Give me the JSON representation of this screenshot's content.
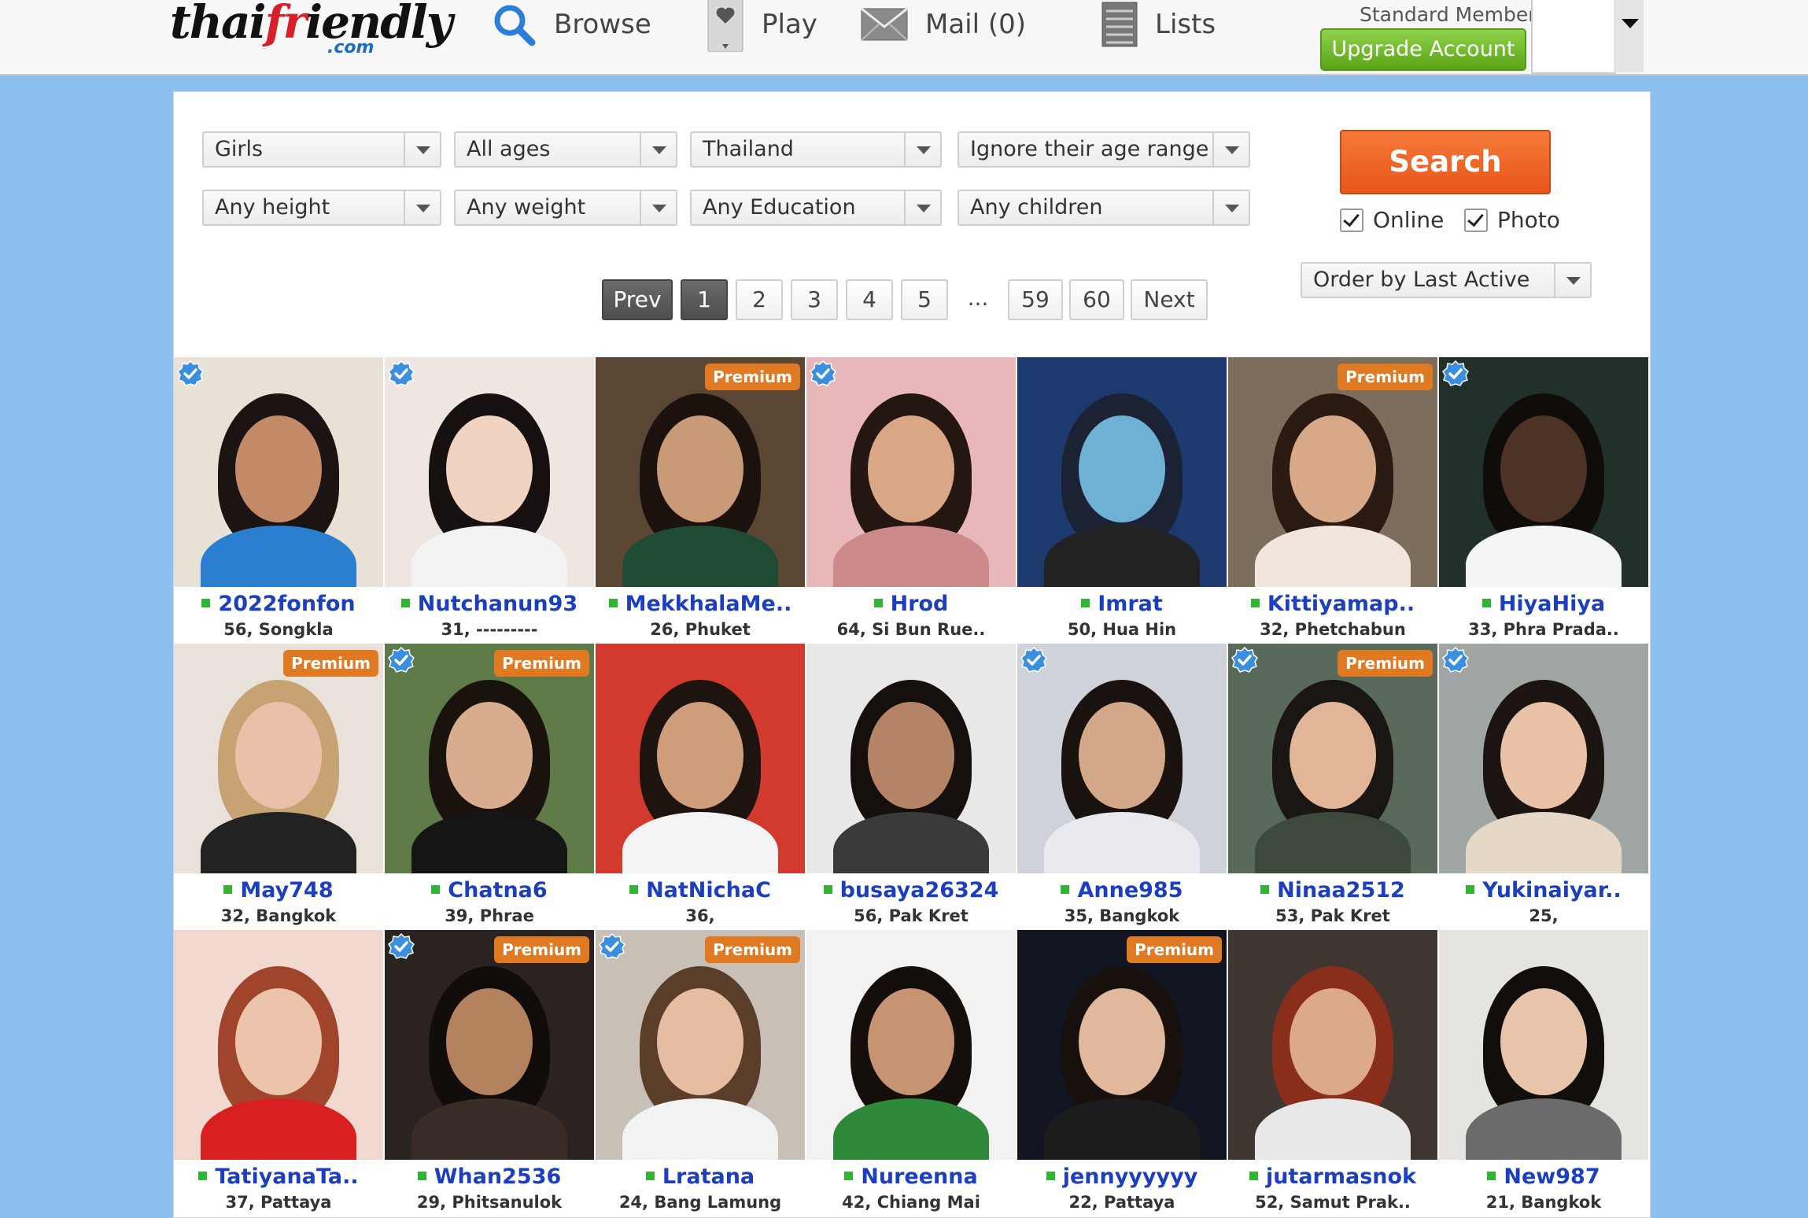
{
  "header": {
    "logo_text_a": "thai",
    "logo_text_b": "fr",
    "logo_text_c": "iendly",
    "logo_com": ".com",
    "nav": [
      {
        "label": "Browse",
        "icon": "search-icon"
      },
      {
        "label": "Play",
        "icon": "heart-card-icon"
      },
      {
        "label": "Mail (0)",
        "icon": "mail-icon"
      },
      {
        "label": "Lists",
        "icon": "list-icon"
      }
    ],
    "member_status": "Standard Member",
    "upgrade_label": "Upgrade Account"
  },
  "filters": {
    "row1": [
      "Girls",
      "All ages",
      "Thailand",
      "Ignore their age range"
    ],
    "row2": [
      "Any height",
      "Any weight",
      "Any Education",
      "Any children"
    ],
    "search_label": "Search",
    "online_label": "Online",
    "photo_label": "Photo",
    "order_label": "Order by Last Active"
  },
  "pager": {
    "prev": "Prev",
    "pages": [
      "1",
      "2",
      "3",
      "4",
      "5",
      "...",
      "59",
      "60"
    ],
    "current": "1",
    "next": "Next"
  },
  "badges": {
    "premium": "Premium"
  },
  "profiles": [
    {
      "name": "2022fonfon",
      "info": "56, Songkla",
      "verified": true,
      "premium": false,
      "bg": "#e8e2d6",
      "skin": "#c28a66",
      "hair": "#1b1412",
      "top": "#2a7fd0"
    },
    {
      "name": "Nutchanun93",
      "info": "31, ---------",
      "verified": true,
      "premium": false,
      "bg": "#efe6e2",
      "skin": "#f1d3c2",
      "hair": "#161010",
      "top": "#f3f3f3"
    },
    {
      "name": "MekkhalaMe..",
      "info": "26, Phuket",
      "verified": false,
      "premium": true,
      "bg": "#5b4634",
      "skin": "#c99a78",
      "hair": "#1b120e",
      "top": "#1f4a33"
    },
    {
      "name": "Hrod",
      "info": "64, Si Bun Rue..",
      "verified": true,
      "premium": false,
      "bg": "#e8b7b9",
      "skin": "#d9a786",
      "hair": "#241610",
      "top": "#cc8a8a"
    },
    {
      "name": "Imrat",
      "info": "50, Hua Hin",
      "verified": false,
      "premium": false,
      "bg": "#1d3a6e",
      "skin": "#6fb1d4",
      "hair": "#1a2233",
      "top": "#222"
    },
    {
      "name": "Kittiyamap..",
      "info": "32, Phetchabun",
      "verified": false,
      "premium": true,
      "bg": "#7d6d5c",
      "skin": "#d8a988",
      "hair": "#2a1a12",
      "top": "#f0e6de"
    },
    {
      "name": "HiyaHiya",
      "info": "33, Phra Prada..",
      "verified": true,
      "premium": false,
      "bg": "#22302a",
      "skin": "#4d3326",
      "hair": "#0f0c0a",
      "top": "#f5f5f5"
    },
    {
      "name": "May748",
      "info": "32, Bangkok",
      "verified": false,
      "premium": true,
      "bg": "#e9e2da",
      "skin": "#e9c0a8",
      "hair": "#c7a273",
      "top": "#222"
    },
    {
      "name": "Chatna6",
      "info": "39, Phrae",
      "verified": true,
      "premium": true,
      "bg": "#5d7a47",
      "skin": "#d8ad8d",
      "hair": "#1a120d",
      "top": "#151515"
    },
    {
      "name": "NatNichaC",
      "info": "36,",
      "verified": false,
      "premium": false,
      "bg": "#d23a2e",
      "skin": "#cf9d7c",
      "hair": "#1d140f",
      "top": "#f4f4f4"
    },
    {
      "name": "busaya26324",
      "info": "56, Pak Kret",
      "verified": false,
      "premium": false,
      "bg": "#e8e8e8",
      "skin": "#b58466",
      "hair": "#15100d",
      "top": "#3a3a3a"
    },
    {
      "name": "Anne985",
      "info": "35, Bangkok",
      "verified": true,
      "premium": false,
      "bg": "#cfd2d8",
      "skin": "#d3a888",
      "hair": "#19120e",
      "top": "#e9e9ef"
    },
    {
      "name": "Ninaa2512",
      "info": "53, Pak Kret",
      "verified": true,
      "premium": true,
      "bg": "#5a6a5a",
      "skin": "#e2b597",
      "hair": "#1a1614",
      "top": "#3d4a3b"
    },
    {
      "name": "Yukinaiyar..",
      "info": "25,",
      "verified": true,
      "premium": false,
      "bg": "#9fa6a3",
      "skin": "#e9c2a8",
      "hair": "#1b1411",
      "top": "#e6d8c6"
    },
    {
      "name": "TatiyanaTa..",
      "info": "37, Pattaya",
      "verified": false,
      "premium": false,
      "bg": "#f1d9cf",
      "skin": "#ecc3ab",
      "hair": "#a0452b",
      "top": "#d92020"
    },
    {
      "name": "Whan2536",
      "info": "29, Phitsanulok",
      "verified": true,
      "premium": true,
      "bg": "#2a2320",
      "skin": "#b5825f",
      "hair": "#120d0b",
      "top": "#3a2c26"
    },
    {
      "name": "Lratana",
      "info": "24, Bang Lamung",
      "verified": true,
      "premium": true,
      "bg": "#c8c0b6",
      "skin": "#e6bda0",
      "hair": "#5a3e2a",
      "top": "#f2f2f2"
    },
    {
      "name": "Nureenna",
      "info": "42, Chiang Mai",
      "verified": false,
      "premium": false,
      "bg": "#f2f2f2",
      "skin": "#c69472",
      "hair": "#150f0c",
      "top": "#2e8a3a"
    },
    {
      "name": "jennyyyyyy",
      "info": "22, Pattaya",
      "verified": false,
      "premium": true,
      "bg": "#111522",
      "skin": "#e1b89c",
      "hair": "#17100c",
      "top": "#1c1c1c"
    },
    {
      "name": "jutarmasnok",
      "info": "52, Samut Prak..",
      "verified": false,
      "premium": false,
      "bg": "#3f3631",
      "skin": "#dcaa88",
      "hair": "#8a2e1c",
      "top": "#e8e8e8"
    },
    {
      "name": "New987",
      "info": "21, Bangkok",
      "verified": false,
      "premium": false,
      "bg": "#e6e4e0",
      "skin": "#e8c4aa",
      "hair": "#120e0c",
      "top": "#6b6b6b"
    }
  ]
}
